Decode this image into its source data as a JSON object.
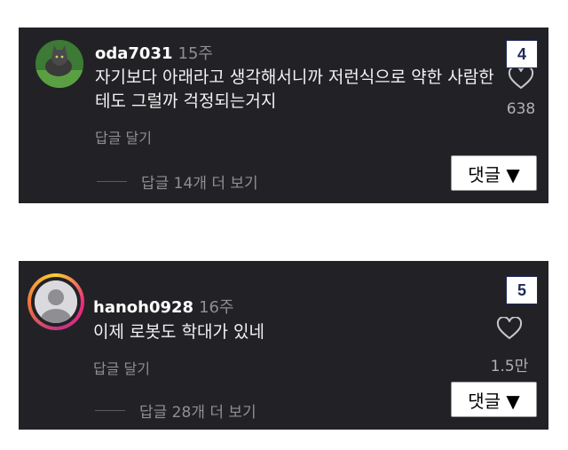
{
  "comments": [
    {
      "username": "oda7031",
      "time": "15주",
      "text": "자기보다 아래라고 생각해서니까 저런식으로 약한 사람한테도 그럴까 걱정되는거지",
      "reply_label": "답글 달기",
      "view_replies": "답글 14개 더 보기",
      "likes": "638",
      "number_badge": "4",
      "sort_label": "댓글 ▼",
      "avatar_icon": "cat-photo-icon"
    },
    {
      "username": "hanoh0928",
      "time": "16주",
      "text": "이제 로봇도 학대가 있네",
      "reply_label": "답글 달기",
      "view_replies": "답글 28개 더 보기",
      "likes": "1.5만",
      "number_badge": "5",
      "sort_label": "댓글 ▼",
      "avatar_icon": "default-user-icon"
    }
  ],
  "colors": {
    "card_bg": "#222226",
    "secondary_text": "#8e8e93",
    "badge_border": "#1f2a5a"
  }
}
